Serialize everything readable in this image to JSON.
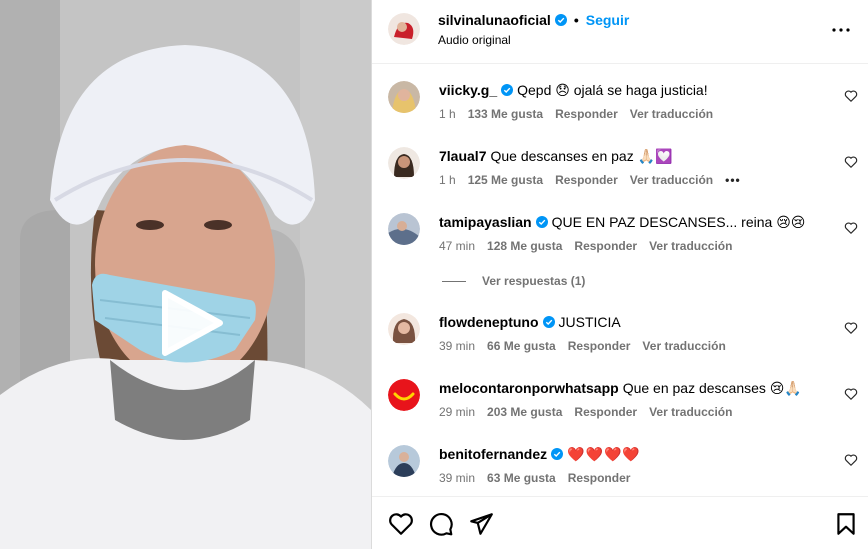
{
  "header": {
    "username": "silvinalunaoficial",
    "follow_label": "Seguir",
    "subtitle": "Audio original",
    "more_icon": "more-horizontal-icon"
  },
  "comments": [
    {
      "username": "viicky.g_",
      "verified": true,
      "text": "Qepd 😞 ojalá se haga justicia!",
      "time": "1 h",
      "likes": "133 Me gusta",
      "reply": "Responder",
      "translate": "Ver traducción"
    },
    {
      "username": "7laual7",
      "verified": false,
      "text": "Que descanses en paz 🙏🏻💟",
      "time": "1 h",
      "likes": "125 Me gusta",
      "reply": "Responder",
      "translate": "Ver traducción",
      "more": "•••"
    },
    {
      "username": "tamipayaslian",
      "verified": true,
      "text": "QUE EN PAZ DESCANSES... reina 😢😢",
      "time": "47 min",
      "likes": "128 Me gusta",
      "reply": "Responder",
      "translate": "Ver traducción"
    },
    {
      "username": "flowdeneptuno",
      "verified": true,
      "text": "JUSTICIA",
      "time": "39 min",
      "likes": "66 Me gusta",
      "reply": "Responder",
      "translate": "Ver traducción"
    },
    {
      "username": "melocontaronporwhatsapp",
      "verified": false,
      "text": "Que en paz descanses 😢🙏🏻",
      "time": "29 min",
      "likes": "203 Me gusta",
      "reply": "Responder",
      "translate": "Ver traducción"
    },
    {
      "username": "benitofernandez",
      "verified": true,
      "text": "❤️❤️❤️❤️",
      "time": "39 min",
      "likes": "63 Me gusta",
      "reply": "Responder"
    }
  ],
  "replies_label": "Ver respuestas (1)",
  "actions": {
    "like_icon": "heart-icon",
    "comment_icon": "comment-icon",
    "share_icon": "send-icon",
    "save_icon": "bookmark-icon"
  },
  "colors": {
    "link_blue": "#0095f6",
    "muted_gray": "#737373",
    "verified_blue": "#0095f6"
  }
}
